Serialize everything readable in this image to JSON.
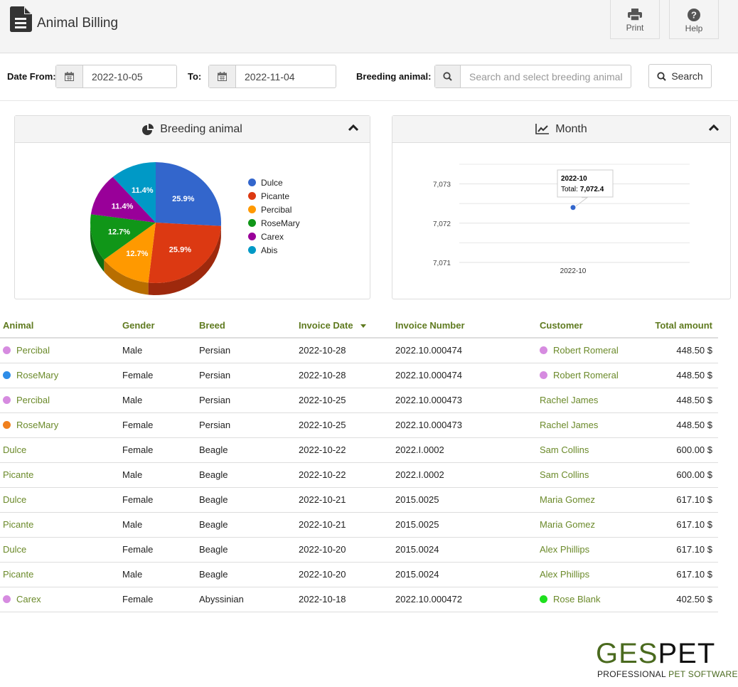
{
  "header": {
    "title": "Animal Billing",
    "print_label": "Print",
    "help_label": "Help"
  },
  "filters": {
    "date_from_label": "Date From:",
    "date_from_value": "2022-10-05",
    "to_label": "To:",
    "to_value": "2022-11-04",
    "breeding_label": "Breeding animal:",
    "breeding_placeholder": "Search and select breeding animal",
    "search_label": "Search"
  },
  "panels": {
    "pie_title": "Breeding animal",
    "line_title": "Month"
  },
  "chart_data": [
    {
      "type": "pie",
      "title": "Breeding animal",
      "categories": [
        "Dulce",
        "Picante",
        "Percibal",
        "RoseMary",
        "Carex",
        "Abis"
      ],
      "values": [
        25.9,
        25.9,
        12.7,
        12.7,
        11.4,
        11.4
      ],
      "labels": [
        "25.9%",
        "25.9%",
        "12.7%",
        "12.7%",
        "11.4%",
        "11.4%"
      ],
      "colors": [
        "#3366cc",
        "#dc3912",
        "#ff9900",
        "#109618",
        "#990099",
        "#0099c6"
      ],
      "legend": "right",
      "style": "3d"
    },
    {
      "type": "line",
      "title": "Month",
      "x": [
        "2022-10"
      ],
      "series": [
        {
          "name": "Total",
          "values": [
            7072.4
          ]
        }
      ],
      "ylim": [
        7071,
        7073.5
      ],
      "yticks": [
        "7,071",
        "7,072",
        "7,073"
      ],
      "grid": true,
      "tooltip": {
        "title": "2022-10",
        "label": "Total:",
        "value": "7,072.4"
      }
    }
  ],
  "table": {
    "columns": [
      "Animal",
      "Gender",
      "Breed",
      "Invoice Date",
      "Invoice Number",
      "Customer",
      "Total amount"
    ],
    "rows": [
      {
        "animal": "Percibal",
        "animal_dot": "#d68be0",
        "gender": "Male",
        "breed": "Persian",
        "date": "2022-10-28",
        "number": "2022.10.000474",
        "customer": "Robert Romeral",
        "customer_dot": "#d68be0",
        "total": "448.50 $"
      },
      {
        "animal": "RoseMary",
        "animal_dot": "#2e8de8",
        "gender": "Female",
        "breed": "Persian",
        "date": "2022-10-28",
        "number": "2022.10.000474",
        "customer": "Robert Romeral",
        "customer_dot": "#d68be0",
        "total": "448.50 $"
      },
      {
        "animal": "Percibal",
        "animal_dot": "#d68be0",
        "gender": "Male",
        "breed": "Persian",
        "date": "2022-10-25",
        "number": "2022.10.000473",
        "customer": "Rachel James",
        "customer_dot": "",
        "total": "448.50 $"
      },
      {
        "animal": "RoseMary",
        "animal_dot": "#f0801e",
        "gender": "Female",
        "breed": "Persian",
        "date": "2022-10-25",
        "number": "2022.10.000473",
        "customer": "Rachel James",
        "customer_dot": "",
        "total": "448.50 $"
      },
      {
        "animal": "Dulce",
        "animal_dot": "",
        "gender": "Female",
        "breed": "Beagle",
        "date": "2022-10-22",
        "number": "2022.I.0002",
        "customer": "Sam Collins",
        "customer_dot": "",
        "total": "600.00 $"
      },
      {
        "animal": "Picante",
        "animal_dot": "",
        "gender": "Male",
        "breed": "Beagle",
        "date": "2022-10-22",
        "number": "2022.I.0002",
        "customer": "Sam Collins",
        "customer_dot": "",
        "total": "600.00 $"
      },
      {
        "animal": "Dulce",
        "animal_dot": "",
        "gender": "Female",
        "breed": "Beagle",
        "date": "2022-10-21",
        "number": "2015.0025",
        "customer": "Maria Gomez",
        "customer_dot": "",
        "total": "617.10 $"
      },
      {
        "animal": "Picante",
        "animal_dot": "",
        "gender": "Male",
        "breed": "Beagle",
        "date": "2022-10-21",
        "number": "2015.0025",
        "customer": "Maria Gomez",
        "customer_dot": "",
        "total": "617.10 $"
      },
      {
        "animal": "Dulce",
        "animal_dot": "",
        "gender": "Female",
        "breed": "Beagle",
        "date": "2022-10-20",
        "number": "2015.0024",
        "customer": "Alex Phillips",
        "customer_dot": "",
        "total": "617.10 $"
      },
      {
        "animal": "Picante",
        "animal_dot": "",
        "gender": "Male",
        "breed": "Beagle",
        "date": "2022-10-20",
        "number": "2015.0024",
        "customer": "Alex Phillips",
        "customer_dot": "",
        "total": "617.10 $"
      },
      {
        "animal": "Carex",
        "animal_dot": "#d68be0",
        "gender": "Female",
        "breed": "Abyssinian",
        "date": "2022-10-18",
        "number": "2022.10.000472",
        "customer": "Rose Blank",
        "customer_dot": "#1ee01e",
        "total": "402.50 $"
      }
    ]
  },
  "logo": {
    "part1": "GES",
    "part2": "PET",
    "tag1": "PROFESSIONAL ",
    "tag2": "PET SOFTWARE",
    "green": "#4a6a1e"
  }
}
